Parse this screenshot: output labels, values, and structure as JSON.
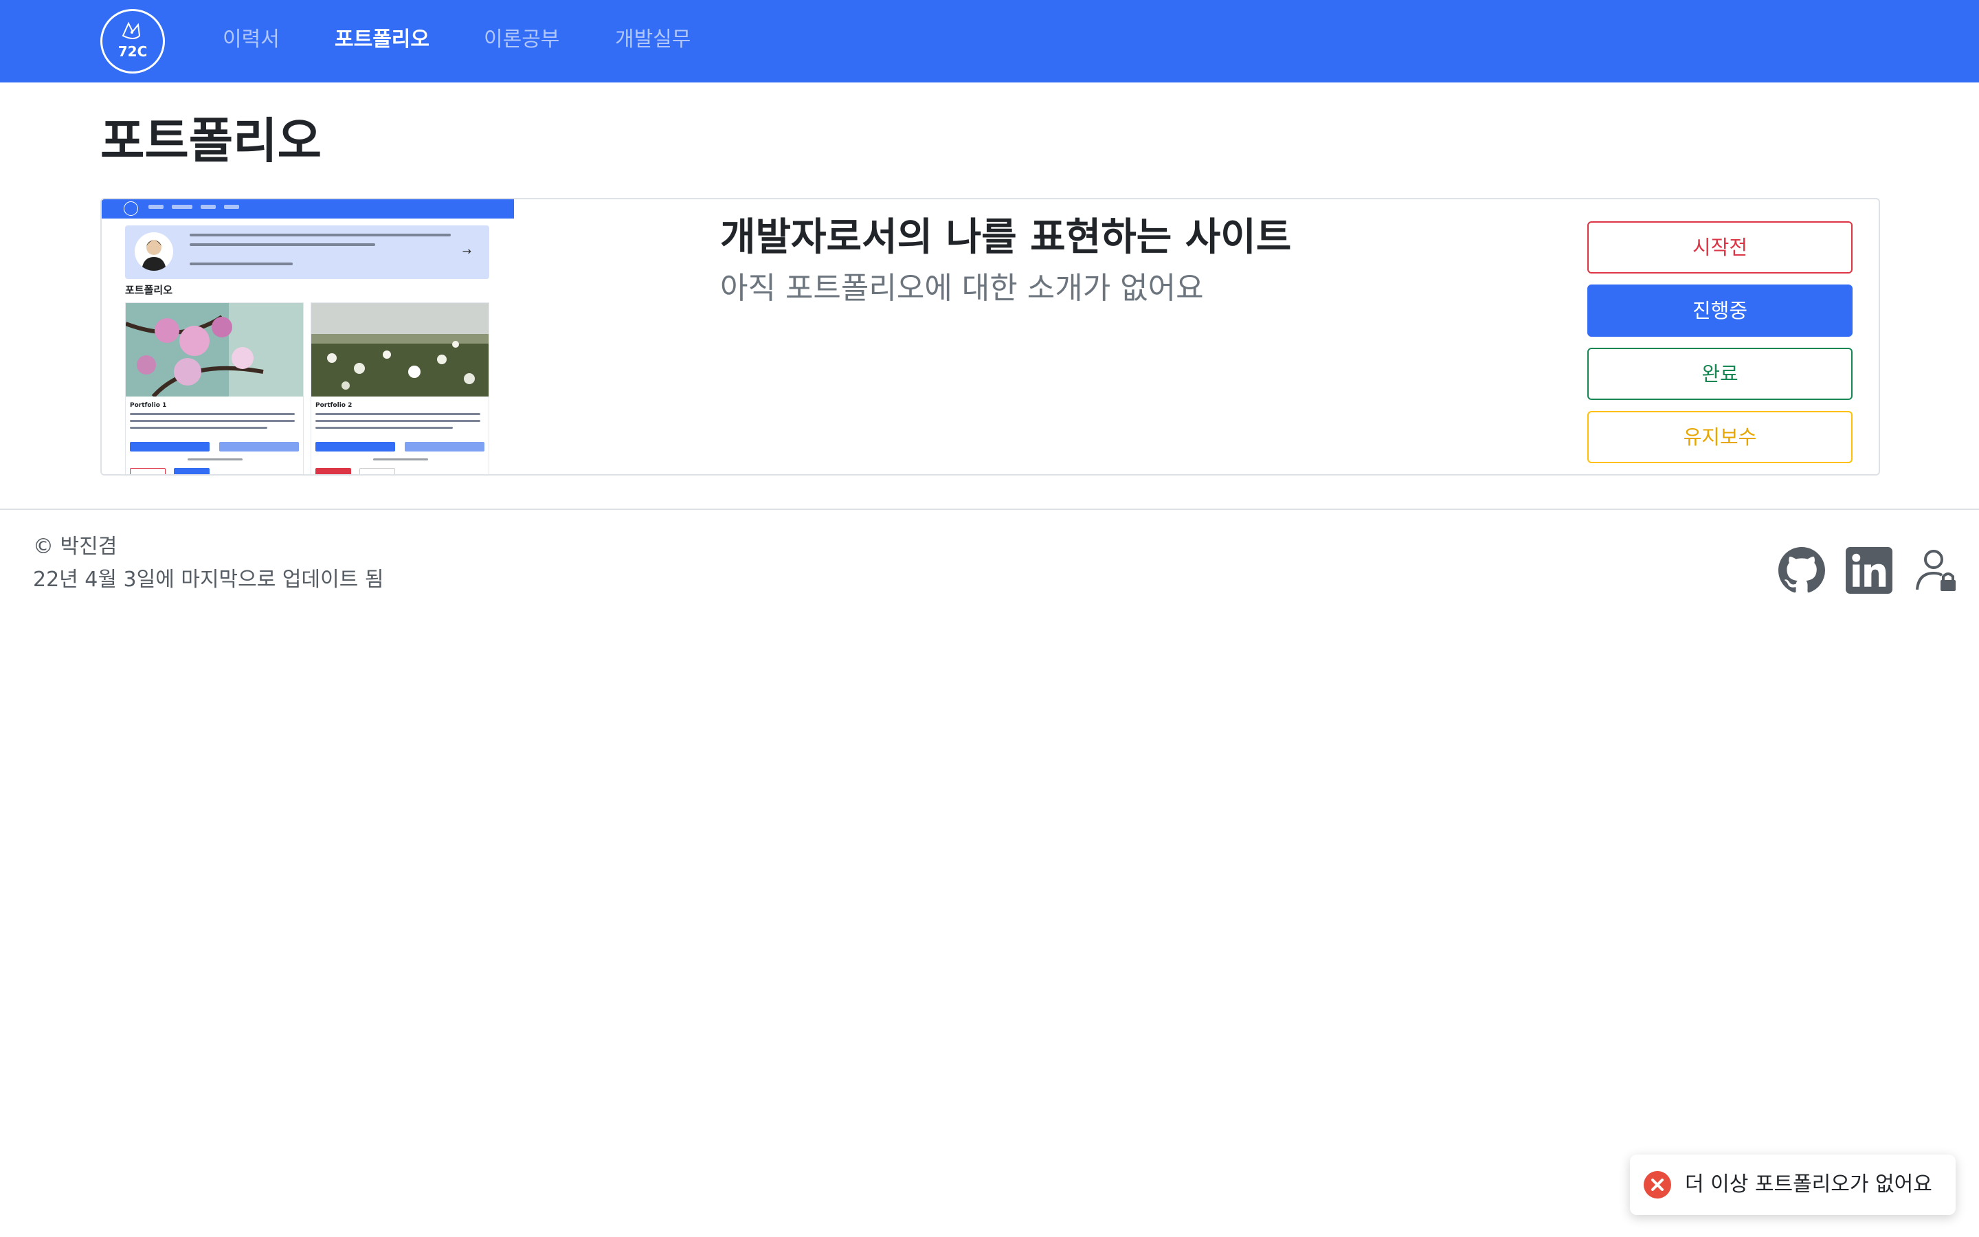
{
  "navbar": {
    "logo_text": "72C",
    "items": [
      {
        "label": "이력서"
      },
      {
        "label": "포트폴리오"
      },
      {
        "label": "이론공부"
      },
      {
        "label": "개발실무"
      }
    ],
    "active_item": "포트폴리오",
    "background": "#336df5"
  },
  "page": {
    "title": "포트폴리오"
  },
  "portfolio_card": {
    "title": "개발자로서의 나를 표현하는 사이트",
    "description": "아직 포트폴리오에 대한 소개가 없어요",
    "thumbnail": {
      "section_title": "포트폴리오",
      "items": [
        {
          "title": "Portfolio 1"
        },
        {
          "title": "Portfolio 2"
        }
      ]
    },
    "status_buttons": [
      {
        "label": "시작전",
        "color": "#dc3545"
      },
      {
        "label": "진행중",
        "color": "#336df5",
        "selected": true
      },
      {
        "label": "완료",
        "color": "#198754"
      },
      {
        "label": "유지보수",
        "color": "#ffc107"
      }
    ]
  },
  "footer": {
    "copyright": "© 박진겸",
    "updated": "22년 4월 3일에 마지막으로 업데이트 됨",
    "icons": [
      "github-icon",
      "linkedin-icon",
      "user-lock-icon"
    ]
  },
  "toast": {
    "message": "더 이상 포트폴리오가 없어요",
    "type": "error",
    "color": "#e74c3c"
  }
}
